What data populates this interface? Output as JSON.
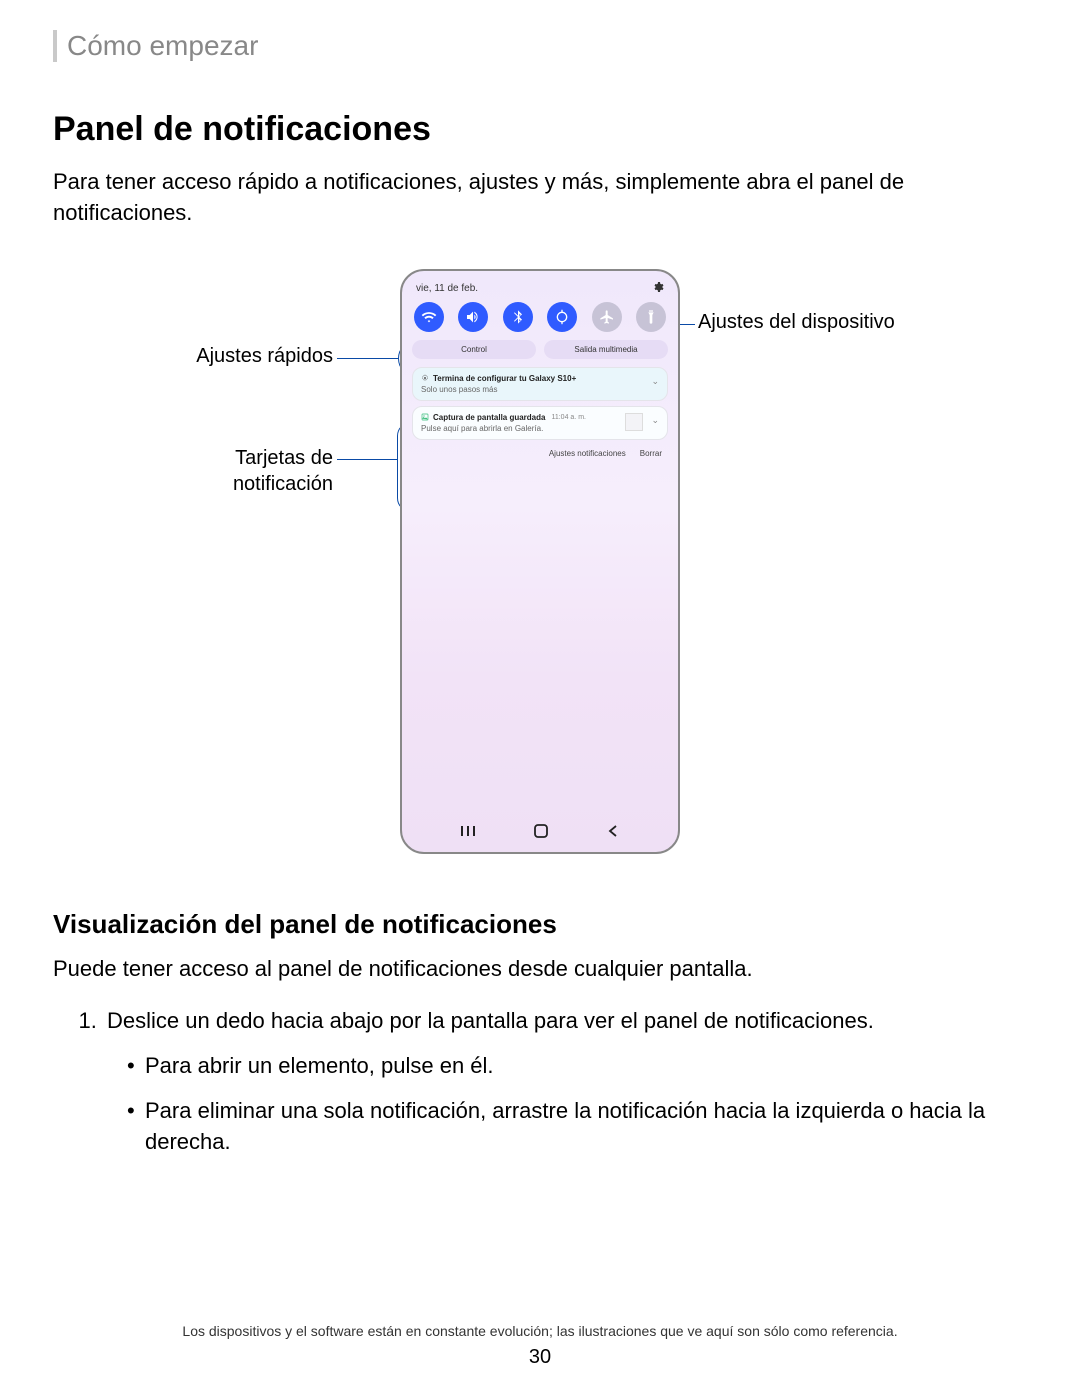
{
  "breadcrumb": "Cómo empezar",
  "title": "Panel de notificaciones",
  "lead": "Para tener acceso rápido a notificaciones, ajustes y más, simplemente abra el panel de notificaciones.",
  "callouts": {
    "quick_settings": "Ajustes rápidos",
    "device_settings": "Ajustes del dispositivo",
    "notif_cards_l1": "Tarjetas de",
    "notif_cards_l2": "notificación"
  },
  "phone": {
    "date": "vie, 11 de feb.",
    "media_control": "Control",
    "media_output": "Salida multimedia",
    "notif1_title": "Termina de configurar tu Galaxy S10+",
    "notif1_sub": "Solo unos pasos más",
    "notif2_title": "Captura de pantalla guardada",
    "notif2_time": "11:04 a. m.",
    "notif2_sub": "Pulse aquí para abrirla en Galería.",
    "action_settings": "Ajustes notificaciones",
    "action_clear": "Borrar"
  },
  "subtitle": "Visualización del panel de notificaciones",
  "body2": "Puede tener acceso al panel de notificaciones desde cualquier pantalla.",
  "step1": "Deslice un dedo hacia abajo por la pantalla para ver el panel de notificaciones.",
  "sub1": "Para abrir un elemento, pulse en él.",
  "sub2": "Para eliminar una sola notificación, arrastre la notificación hacia la izquierda o hacia la derecha.",
  "footnote": "Los dispositivos y el software están en constante evolución; las ilustraciones que ve aquí son sólo como referencia.",
  "page": "30"
}
